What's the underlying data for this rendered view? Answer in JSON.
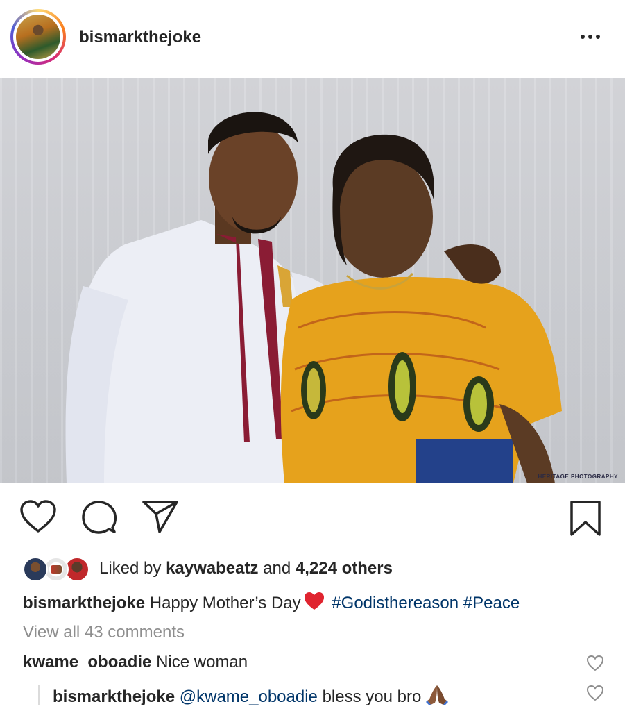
{
  "post": {
    "username": "bismarkthejoke",
    "more_icon": "more-horizontal-icon",
    "photo_watermark": "HERITAGE PHOTOGRAPHY"
  },
  "actions": {
    "icons": [
      "heart-icon",
      "comment-icon",
      "share-icon",
      "bookmark-icon"
    ]
  },
  "likes": {
    "prefix": "Liked by",
    "first_liker": "kaywabeatz",
    "conjunction": "and",
    "others": "4,224 others"
  },
  "caption": {
    "username": "bismarkthejoke",
    "text": "Happy Mother’s Day",
    "emoji": "red-heart",
    "hashtag1": "#Godisthereason",
    "hashtag2": "#Peace"
  },
  "view_all_comments": "View all 43 comments",
  "comments": [
    {
      "username": "kwame_oboadie",
      "text": "Nice woman"
    },
    {
      "username": "bismarkthejoke",
      "mention": "@kwame_oboadie",
      "text": "bless you bro",
      "emoji": "folded-hands"
    }
  ],
  "colors": {
    "text": "#262626",
    "link": "#003569",
    "muted": "#8e8e8e",
    "heart": "#e0242f"
  }
}
